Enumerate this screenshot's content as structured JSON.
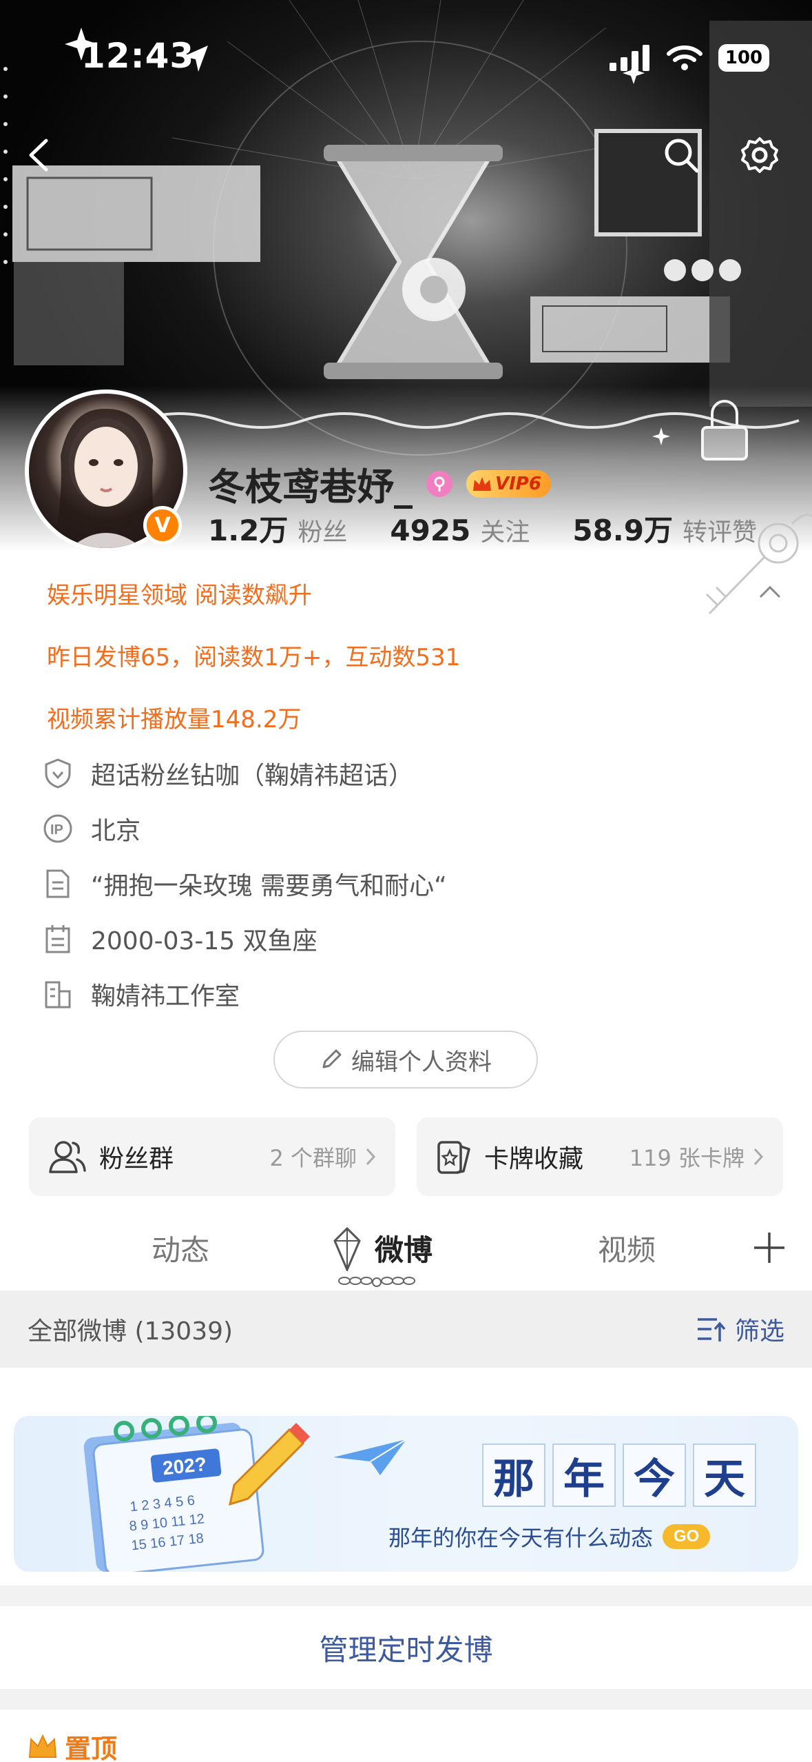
{
  "status_bar": {
    "time": "12:43",
    "battery": "100"
  },
  "profile": {
    "username": "冬枝鸢巷妤_",
    "vip_label": "VIP6",
    "verify_mark": "V",
    "stats": [
      {
        "value": "1.2万",
        "label": "粉丝"
      },
      {
        "value": "4925",
        "label": "关注"
      },
      {
        "value": "58.9万",
        "label": "转评赞"
      }
    ]
  },
  "highlights": [
    "娱乐明星领域 阅读数飙升",
    "昨日发博65，阅读数1万+，互动数531",
    "视频累计播放量148.2万"
  ],
  "info": [
    {
      "icon": "shield-icon",
      "text": "超话粉丝钻咖（鞠婧祎超话）"
    },
    {
      "icon": "ip-icon",
      "text": "北京"
    },
    {
      "icon": "document-icon",
      "text": "“拥抱一朵玫瑰 需要勇气和耐心“"
    },
    {
      "icon": "calendar-icon",
      "text": "2000-03-15 双鱼座"
    },
    {
      "icon": "company-icon",
      "text": "鞠婧祎工作室"
    }
  ],
  "edit_profile_label": "编辑个人资料",
  "cards": [
    {
      "title": "粉丝群",
      "meta": "2 个群聊"
    },
    {
      "title": "卡牌收藏",
      "meta": "119 张卡牌"
    }
  ],
  "tabs": [
    "动态",
    "微博",
    "视频"
  ],
  "active_tab": "微博",
  "filter": {
    "label": "全部微博 (13039)",
    "button": "筛选"
  },
  "promo": {
    "title_chars": [
      "那",
      "年",
      "今",
      "天"
    ],
    "subtitle": "那年的你在今天有什么动态",
    "go": "GO",
    "calendar_year": "202?"
  },
  "manage_label": "管理定时发博",
  "pinned_label": "置顶",
  "colors": {
    "accent": "#f46d1c",
    "link_blue": "#3d5a9e",
    "vip_gold": "#ff9b26"
  }
}
